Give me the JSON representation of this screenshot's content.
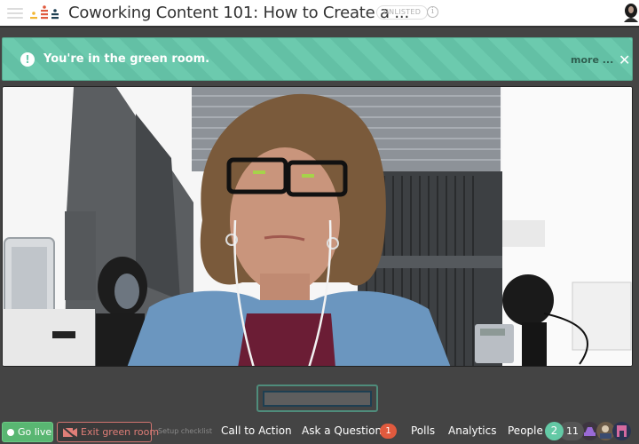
{
  "header": {
    "menu_icon": "hamburger-icon",
    "logo_icon": "crowdcast-logo-icon",
    "title": "Coworking Content 101: How to Create a ...",
    "visibility_badge": "UNLISTED",
    "info_icon": "info-icon",
    "info_glyph": "i",
    "user_avatar": "user-avatar"
  },
  "banner": {
    "icon": "exclamation-icon",
    "icon_glyph": "!",
    "message": "You're in the green room.",
    "more_link": "more ...",
    "close_glyph": "✕",
    "color": "#6ccaae"
  },
  "video": {
    "description": "Host webcam feed"
  },
  "toolbar": {
    "go_live": "Go live",
    "exit_green_room": "Exit green room",
    "setup_checklist": "Setup checklist",
    "call_to_action": "Call to Action",
    "ask_a_question": "Ask a Question",
    "questions_count": "1",
    "polls": "Polls",
    "analytics": "Analytics",
    "people": "People",
    "people_online": "2",
    "people_total": "11",
    "go_live_color": "#59b672",
    "exit_color": "#e07e78",
    "question_badge_color": "#e05a3e",
    "people_badge_color": "#63c9a5"
  },
  "attendees": [
    {
      "name": "attendee-avatar-1"
    },
    {
      "name": "attendee-avatar-2"
    },
    {
      "name": "attendee-avatar-3"
    }
  ]
}
